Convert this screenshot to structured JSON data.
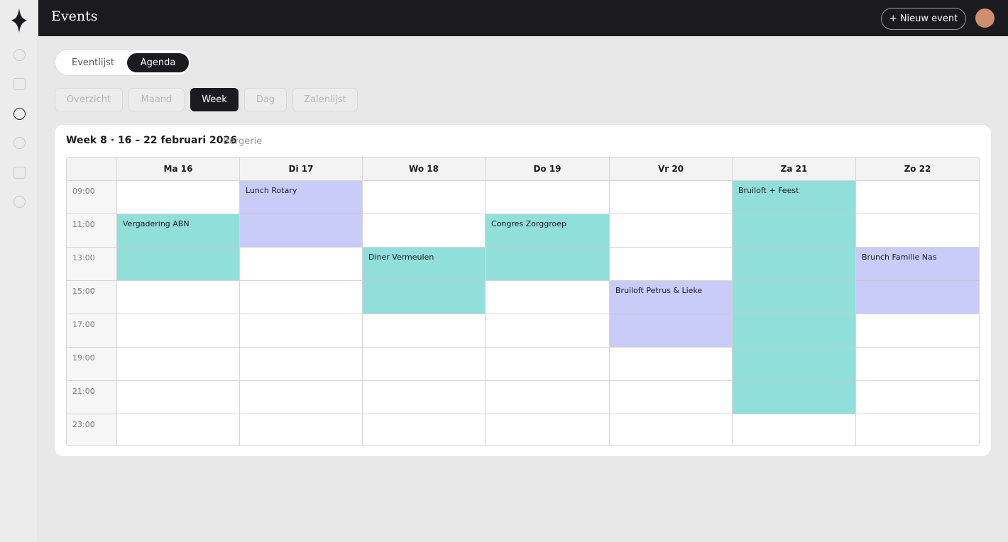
{
  "header": {
    "title": "Events",
    "new_event_label": "+ Nieuw event"
  },
  "sidebar": {
    "icons": [
      "circle-icon",
      "square-icon",
      "circle-icon",
      "circle-icon",
      "square-icon",
      "circle-icon"
    ],
    "active_index": 2
  },
  "view_toggle": {
    "options": [
      "Eventlijst",
      "Agenda"
    ],
    "selected": "Agenda"
  },
  "tabs": [
    "Overzicht",
    "Maand",
    "Week",
    "Dag",
    "Zalenlijst"
  ],
  "active_tab": "Week",
  "calendar": {
    "title": "Week 8 · 16 – 22 februari 2026",
    "subtitle": "Bergerie",
    "days": [
      "Ma 16",
      "Di 17",
      "Wo 18",
      "Do 19",
      "Vr 20",
      "Za 21",
      "Zo 22"
    ],
    "times": [
      "09:00",
      "11:00",
      "13:00",
      "15:00",
      "17:00",
      "19:00",
      "21:00",
      "23:00"
    ],
    "events": [
      {
        "title": "Lunch Rotary",
        "day": 1,
        "start": 0,
        "span": 2,
        "color": "#c9ccf8"
      },
      {
        "title": "Bruiloft + Feest",
        "day": 5,
        "start": 0,
        "span": 7,
        "color": "#91dfdb"
      },
      {
        "title": "Vergadering ABN",
        "day": 0,
        "start": 1,
        "span": 2,
        "color": "#91dfdb"
      },
      {
        "title": "Congres Zorggroep",
        "day": 3,
        "start": 1,
        "span": 2,
        "color": "#91dfdb"
      },
      {
        "title": "Diner Vermeulen",
        "day": 2,
        "start": 2,
        "span": 2,
        "color": "#91dfdb"
      },
      {
        "title": "Brunch Familie Nas",
        "day": 6,
        "start": 2,
        "span": 2,
        "color": "#c9ccf8"
      },
      {
        "title": "Bruiloft Petrus & Lieke",
        "day": 4,
        "start": 3,
        "span": 2,
        "color": "#c9ccf8"
      }
    ]
  }
}
